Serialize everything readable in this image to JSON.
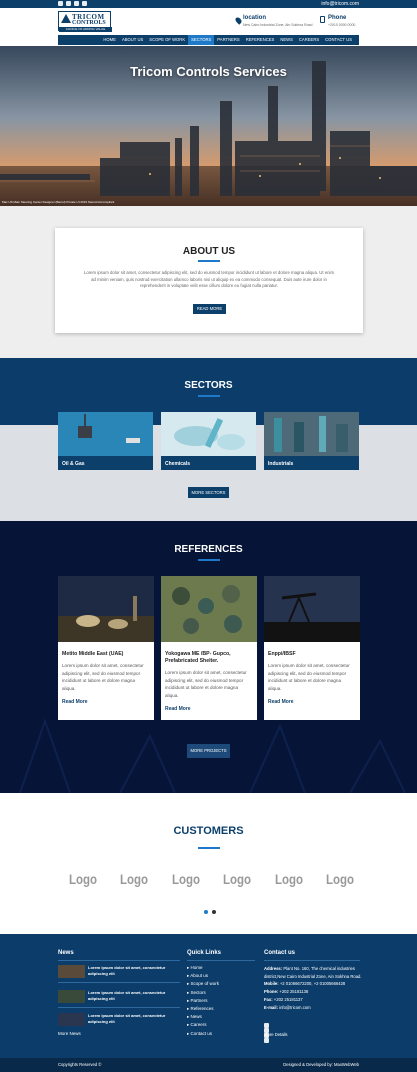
{
  "topbar": {
    "email": "info@tricom.com",
    "social_icons": [
      "facebook-icon",
      "twitter-icon",
      "youtube-icon",
      "google-plus-icon"
    ]
  },
  "header": {
    "logo": {
      "line1": "TRICOM",
      "line2": "CONTROLS",
      "tagline": "CHOICE OF ADDING VALUE"
    },
    "location_title": "location",
    "location_text": "New Cairo Industrial Zone, Ain Sokhna Road",
    "phone_title": "Phone",
    "phone_text": "+2010 0000 0000"
  },
  "nav": [
    "HOME",
    "ABOUT US",
    "SCOPE OF WORK",
    "SECTORS",
    "PARTNERS",
    "REFERENCES",
    "NEWS",
    "CAREERS",
    "CONTACT US"
  ],
  "nav_active_index": 3,
  "hero": {
    "title": "Tricom Controls Services",
    "caption": "Mac US Main Steering Center Designer (Barrel) Private UI 2019 Steroid Accompliant"
  },
  "about": {
    "title": "ABOUT US",
    "text": "Lorem ipsum dolor sit amet, consectetur adipiscing elit, sed do eiusmod tempor incididunt ut labore et dolore magna aliqua. Ut enim ad minim veniam, quis nostrud exercitation ullamco laboris nisi ut aliquip ex ea commodo consequat. Duis aute irure dolor in reprehenderit in voluptate velit esse cillum dolore eu fugiat nulla pariatur.",
    "button": "READ MORE"
  },
  "sectors": {
    "title": "SECTORS",
    "items": [
      "Oil & Gas",
      "Chemicals",
      "Industrials"
    ],
    "button": "MORE SECTORS"
  },
  "references": {
    "title": "REFERENCES",
    "items": [
      {
        "title": "Metito Middle East (UAE)",
        "text": "Lorem ipsum dolor sit amet, consectetur adipiscing elit, sed do eiusmod tempor incididunt ut labore et dolore magna aliqua.",
        "link": "Read More"
      },
      {
        "title": "Yokogawa ME /BP- Gupco, Prefabricated Shelter.",
        "text": "Lorem ipsum dolor sit amet, consectetur adipiscing elit, sed do eiusmod tempor incididunt ut labore et dolore magna aliqua.",
        "link": "Read More"
      },
      {
        "title": "Enppi/IBSF",
        "text": "Lorem ipsum dolor sit amet, consectetur adipiscing elit, sed do eiusmod tempor incididunt ut labore et dolore magna aliqua.",
        "link": "Read More"
      }
    ],
    "button": "MORE PROJECTS"
  },
  "customers": {
    "title": "CUSTOMERS",
    "logos": [
      "Logo",
      "Logo",
      "Logo",
      "Logo",
      "Logo",
      "Logo"
    ],
    "carousel_pages": 2,
    "carousel_active": 0
  },
  "footer": {
    "news_title": "News",
    "news": [
      "Lorem ipsum dolor sit amet, consectetur adipiscing elit",
      "Lorem ipsum dolor sit amet, consectetur adipiscing elit",
      "Lorem ipsum dolor sit amet, consectetur adipiscing elit"
    ],
    "more_news": "More News",
    "quick_title": "Quick Links",
    "quick_links": [
      "Home",
      "About us",
      "Scope of work",
      "Sectors",
      "Partners",
      "References",
      "News",
      "Careers",
      "Contact us"
    ],
    "contact_title": "Contact us",
    "address_label": "Address:",
    "address": "Plant No. 160, The chemical industries district,New Cairo Industrial Zone, Ain Sokhna Road.",
    "mobile_label": "Mobile:",
    "mobile": "+2 01066672200, +2 01005666428",
    "phone_label": "Phone:",
    "phone": "+202 25181138",
    "fax_label": "Fax:",
    "fax": "+202 25181137",
    "email_label": "E-mail:",
    "email": "info@tricom.com",
    "more_details": "More Details"
  },
  "bottom": {
    "copyright": "Copyrights Reserved ©",
    "credit": "Designed & Developed by: MaxWebWeb"
  },
  "colors": {
    "primary": "#0d3f6b",
    "accent": "#1e7ac8",
    "dark": "#061537"
  }
}
